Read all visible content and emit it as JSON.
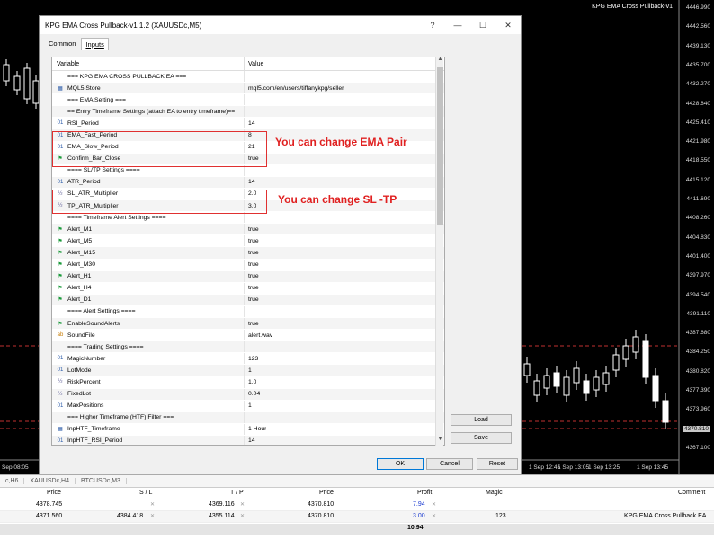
{
  "chart": {
    "title": "KPG EMA Cross Pullback-v1",
    "price_axis": [
      "4446.990",
      "4442.560",
      "4439.130",
      "4435.700",
      "4432.270",
      "4428.840",
      "4425.410",
      "4421.980",
      "4418.550",
      "4415.120",
      "4411.690",
      "4408.260",
      "4404.830",
      "4401.400",
      "4397.970",
      "4394.540",
      "4391.110",
      "4387.680",
      "4384.250",
      "4380.820",
      "4377.390",
      "4373.960",
      "4370.810",
      "4367.100"
    ],
    "current_price": "4370.810",
    "time_axis": [
      "Sep 08:05",
      "1 Sep 12:45",
      "1 Sep 13:05",
      "1 Sep 13:25",
      "1 Sep 13:45"
    ]
  },
  "dialog": {
    "title": "KPG EMA Cross Pullback-v1 1.2 (XAUUSDc,M5)",
    "tabs": [
      "Common",
      "Inputs"
    ],
    "col_variable": "Variable",
    "col_value": "Value",
    "rows": [
      {
        "icon": "none",
        "name": "=== KPG EMA CROSS PULLBACK EA ===",
        "value": ""
      },
      {
        "icon": "grid",
        "name": "MQL5 Store",
        "value": "mql5.com/en/users/tiffanykpg/seller"
      },
      {
        "icon": "none",
        "name": "=== EMA Setting ===",
        "value": ""
      },
      {
        "icon": "none",
        "name": "== Entry Timeframe Settings (attach EA to entry timeframe)==",
        "value": ""
      },
      {
        "icon": "01",
        "name": "RSI_Period",
        "value": "14"
      },
      {
        "icon": "01",
        "name": "EMA_Fast_Period",
        "value": "8"
      },
      {
        "icon": "01",
        "name": "EMA_Slow_Period",
        "value": "21"
      },
      {
        "icon": "flag",
        "name": "Confirm_Bar_Close",
        "value": "true"
      },
      {
        "icon": "none",
        "name": "==== SL/TP Settings ====",
        "value": ""
      },
      {
        "icon": "01",
        "name": "ATR_Period",
        "value": "14"
      },
      {
        "icon": "half",
        "name": "SL_ATR_Multiplier",
        "value": "2.0"
      },
      {
        "icon": "half",
        "name": "TP_ATR_Multiplier",
        "value": "3.0"
      },
      {
        "icon": "none",
        "name": "==== Timeframe Alert Settings ====",
        "value": ""
      },
      {
        "icon": "flag",
        "name": "Alert_M1",
        "value": "true"
      },
      {
        "icon": "flag",
        "name": "Alert_M5",
        "value": "true"
      },
      {
        "icon": "flag",
        "name": "Alert_M15",
        "value": "true"
      },
      {
        "icon": "flag",
        "name": "Alert_M30",
        "value": "true"
      },
      {
        "icon": "flag",
        "name": "Alert_H1",
        "value": "true"
      },
      {
        "icon": "flag",
        "name": "Alert_H4",
        "value": "true"
      },
      {
        "icon": "flag",
        "name": "Alert_D1",
        "value": "true"
      },
      {
        "icon": "none",
        "name": "==== Alert Settings ====",
        "value": ""
      },
      {
        "icon": "flag",
        "name": "EnableSoundAlerts",
        "value": "true"
      },
      {
        "icon": "ab",
        "name": "SoundFile",
        "value": "alert.wav"
      },
      {
        "icon": "none",
        "name": "==== Trading Settings ====",
        "value": ""
      },
      {
        "icon": "01",
        "name": "MagicNumber",
        "value": "123"
      },
      {
        "icon": "01",
        "name": "LotMode",
        "value": "1"
      },
      {
        "icon": "half",
        "name": "RiskPercent",
        "value": "1.0"
      },
      {
        "icon": "half",
        "name": "FixedLot",
        "value": "0.04"
      },
      {
        "icon": "01",
        "name": "MaxPositions",
        "value": "1"
      },
      {
        "icon": "none",
        "name": "=== Higher Timeframe (HTF) Filter ===",
        "value": ""
      },
      {
        "icon": "grid",
        "name": "InpHTF_Timeframe",
        "value": "1 Hour"
      },
      {
        "icon": "01",
        "name": "InpHTF_RSI_Period",
        "value": "14"
      }
    ],
    "annotation_ema": "You can change EMA Pair",
    "annotation_sltp": "You can change SL -TP",
    "load_label": "Load",
    "save_label": "Save",
    "ok_label": "OK",
    "cancel_label": "Cancel",
    "reset_label": "Reset"
  },
  "terminal": {
    "tabs": [
      "c,H6",
      "XAUUSDc,H4",
      "BTCUSDc,M3"
    ],
    "headers": {
      "price": "Price",
      "sl": "S / L",
      "tp": "T / P",
      "price2": "Price",
      "profit": "Profit",
      "magic": "Magic",
      "comment": "Comment"
    },
    "rows": [
      {
        "price": "4378.745",
        "sl": "",
        "tp": "4369.116",
        "price2": "4370.810",
        "profit": "7.94",
        "magic": "",
        "comment": ""
      },
      {
        "price": "4371.560",
        "sl": "4384.418",
        "tp": "4355.114",
        "price2": "4370.810",
        "profit": "3.00",
        "magic": "123",
        "comment": "KPG EMA Cross Pullback EA"
      }
    ],
    "total": "10.94"
  }
}
